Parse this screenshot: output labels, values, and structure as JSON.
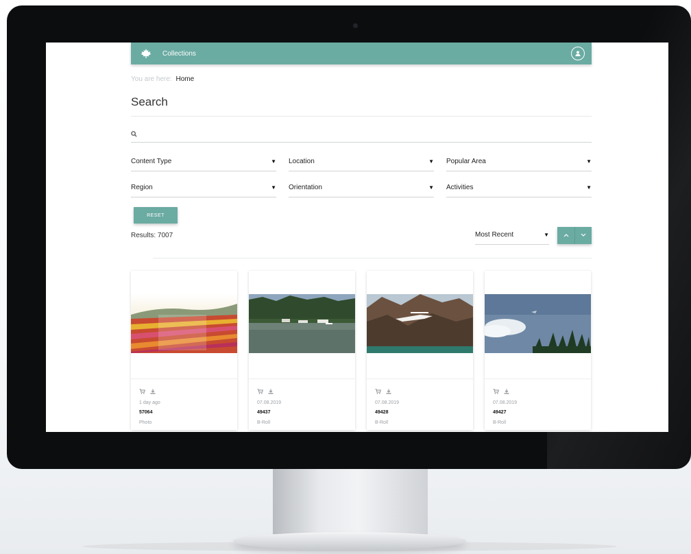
{
  "header": {
    "title": "Collections",
    "logo_icon": "maple-leaf-icon",
    "user_icon": "user-icon",
    "accent_color": "#6aaba2"
  },
  "breadcrumb": {
    "prefix": "You are here:",
    "current": "Home"
  },
  "page": {
    "title": "Search"
  },
  "search": {
    "placeholder": "",
    "value": "",
    "icon": "search-icon"
  },
  "filters": [
    {
      "label": "Content Type"
    },
    {
      "label": "Location"
    },
    {
      "label": "Popular Area"
    },
    {
      "label": "Region"
    },
    {
      "label": "Orientation"
    },
    {
      "label": "Activities"
    }
  ],
  "reset": {
    "label": "RESET"
  },
  "results": {
    "text": "Results: 7007"
  },
  "sort": {
    "selected": "Most Recent",
    "asc_icon": "chevron-up-icon",
    "desc_icon": "chevron-down-icon"
  },
  "cards": [
    {
      "date": "1 day ago",
      "id": "57064",
      "type": "Photo",
      "thumbnail": "tulip-field"
    },
    {
      "date": "07.08.2019",
      "id": "49437",
      "type": "B-Roll",
      "thumbnail": "floatplanes-on-lake"
    },
    {
      "date": "07.08.2019",
      "id": "49428",
      "type": "B-Roll",
      "thumbnail": "floatplane-over-mountains"
    },
    {
      "date": "07.08.2019",
      "id": "49427",
      "type": "B-Roll",
      "thumbnail": "plane-over-forest"
    }
  ]
}
